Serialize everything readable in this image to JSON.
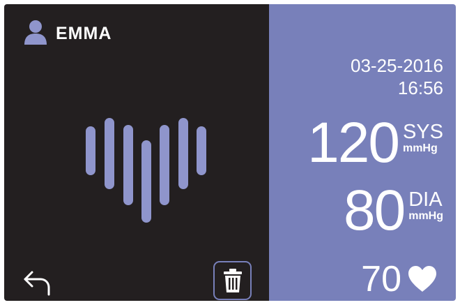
{
  "user": {
    "name": "EMMA",
    "icon": "user-icon"
  },
  "measurement": {
    "date": "03-25-2016",
    "time": "16:56",
    "systolic": {
      "value": "120",
      "label": "SYS",
      "unit": "mmHg"
    },
    "diastolic": {
      "value": "80",
      "label": "DIA",
      "unit": "mmHg"
    },
    "pulse": {
      "value": "70",
      "icon": "heart-icon"
    }
  },
  "controls": {
    "back_icon": "back-arrow-icon",
    "delete_icon": "trash-icon"
  },
  "colors": {
    "left_panel": "#231f20",
    "right_panel": "#7880ba",
    "accent_bars": "#8f95cc",
    "text": "#ffffff"
  }
}
